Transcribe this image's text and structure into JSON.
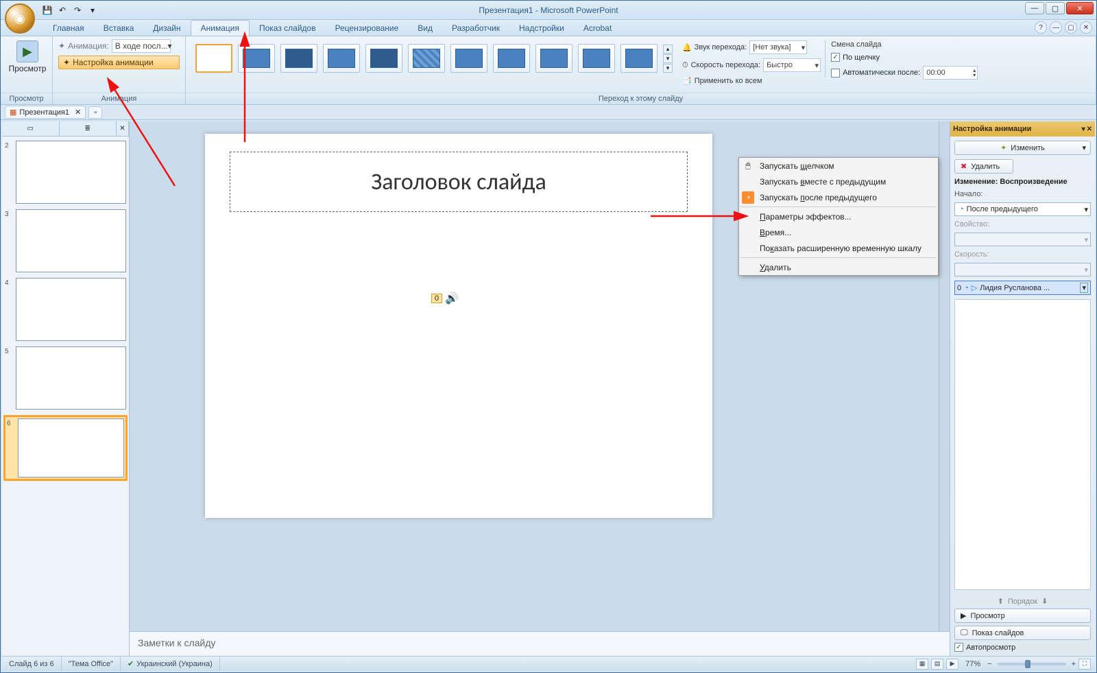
{
  "app": {
    "title": "Презентация1 - Microsoft PowerPoint"
  },
  "qat": {
    "save": "💾",
    "undo": "↶",
    "redo": "↷",
    "more": "▾"
  },
  "tabs": {
    "home": "Главная",
    "insert": "Вставка",
    "design": "Дизайн",
    "animation": "Анимация",
    "slideshow": "Показ слайдов",
    "review": "Рецензирование",
    "view": "Вид",
    "developer": "Разработчик",
    "addins": "Надстройки",
    "acrobat": "Acrobat"
  },
  "ribbon": {
    "preview_grp": "Просмотр",
    "preview_btn": "Просмотр",
    "anim_grp": "Анимация",
    "animate_label": "Анимация:",
    "animate_value": "В ходе посл...",
    "custom_anim_btn": "Настройка анимации",
    "transition_grp": "Переход к этому слайду",
    "sound_label": "Звук перехода:",
    "sound_value": "[Нет звука]",
    "speed_label": "Скорость перехода:",
    "speed_value": "Быстро",
    "apply_all": "Применить ко всем",
    "advance_title": "Смена слайда",
    "on_click": "По щелчку",
    "auto_after": "Автоматически после:",
    "auto_time": "00:00"
  },
  "doc_tab": {
    "name": "Презентация1"
  },
  "slides": {
    "tab_slides": "▭",
    "tab_outline": "≣",
    "items": [
      {
        "num": "2"
      },
      {
        "num": "3"
      },
      {
        "num": "4"
      },
      {
        "num": "5"
      },
      {
        "num": "6"
      }
    ]
  },
  "slide": {
    "title_text": "Заголовок слайда",
    "sound_tag": "0"
  },
  "notes": {
    "placeholder": "Заметки к слайду"
  },
  "context_menu": {
    "on_click": "Запускать щелчком",
    "with_prev": "Запускать вместе с предыдущим",
    "after_prev": "Запускать после предыдущего",
    "effect_opts": "Параметры эффектов...",
    "timing": "Время...",
    "timeline": "Показать расширенную временную шкалу",
    "remove": "Удалить"
  },
  "anim_pane": {
    "title": "Настройка анимации",
    "change_btn": "Изменить",
    "remove_btn": "Удалить",
    "mod_heading": "Изменение: Воспроизведение",
    "start_label": "Начало:",
    "start_value": "После предыдущего",
    "property_label": "Свойство:",
    "speed_label": "Скорость:",
    "item_index": "0",
    "item_text": "Лидия Русланова ...",
    "order_label": "Порядок",
    "preview_btn": "Просмотр",
    "slideshow_btn": "Показ слайдов",
    "autopreview": "Автопросмотр"
  },
  "status": {
    "slide_num": "Слайд 6 из 6",
    "theme": "\"Тема Office\"",
    "lang": "Украинский (Украина)",
    "zoom": "77%"
  }
}
